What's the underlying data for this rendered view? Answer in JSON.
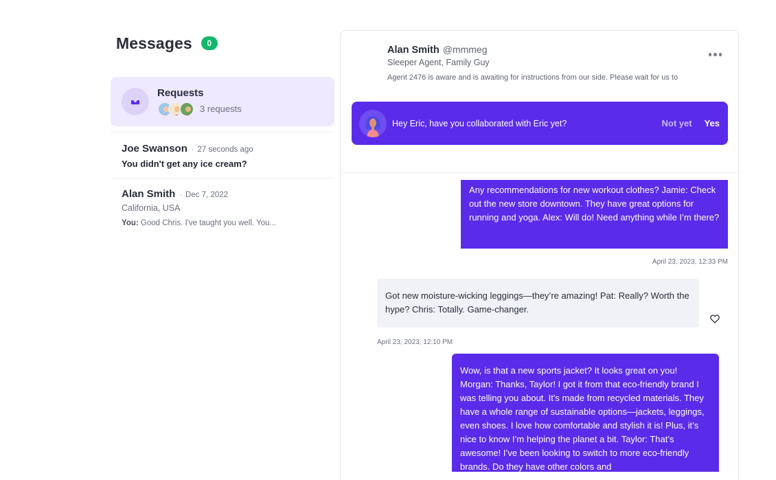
{
  "messages": {
    "title": "Messages",
    "count": "0"
  },
  "requests": {
    "title": "Requests",
    "count_text": "3 requests"
  },
  "conversations": [
    {
      "name": "Joe Swanson",
      "time": "27 seconds ago",
      "preview": "You didn't get any ice cream?"
    },
    {
      "name": "Alan Smith",
      "time": "Dec 7, 2022",
      "location": "California, USA",
      "last_prefix": "You:",
      "last_text": "Good Chris. I've taught you well. You..."
    }
  ],
  "contact": {
    "name": "Alan Smith",
    "handle": "@mmmeg",
    "role": "Sleeper Agent, Family Guy",
    "description": "Agent 2476 is aware and is awaiting for instructions from our side. Please wait for us to"
  },
  "prompt": {
    "question": "Hey Eric, have you collaborated with Eric yet?",
    "no_label": "Not yet",
    "yes_label": "Yes"
  },
  "thread": [
    {
      "direction": "outgoing",
      "text": "Any recommendations for new workout clothes?   Jamie: Check out the new store downtown. They have great options for running and yoga.   Alex: Will do! Need anything while I’m there?",
      "timestamp": "April 23, 2023, 12:33 PM"
    },
    {
      "direction": "incoming",
      "text": "Got new moisture-wicking leggings—they’re amazing!   Pat: Really? Worth the hype?   Chris: Totally. Game-changer.",
      "timestamp": "April 23, 2023, 12:10 PM"
    },
    {
      "direction": "outgoing",
      "text": " Wow, is that a new sports jacket? It looks great on you!  Morgan: Thanks, Taylor! I got it from that eco-friendly brand I was telling you about. It's made from recycled materials. They have a whole range of sustainable options—jackets, leggings, even shoes. I love how comfortable and stylish it is! Plus, it’s nice to know I’m helping the planet a bit.   Taylor: That’s awesome! I’ve been looking to switch to more eco-friendly brands. Do they have other colors and"
    }
  ],
  "colors": {
    "accent": "#5b2bea",
    "badge": "#12b76a",
    "requests_bg": "#efe9ff",
    "incoming_bg": "#f0f2f7"
  }
}
